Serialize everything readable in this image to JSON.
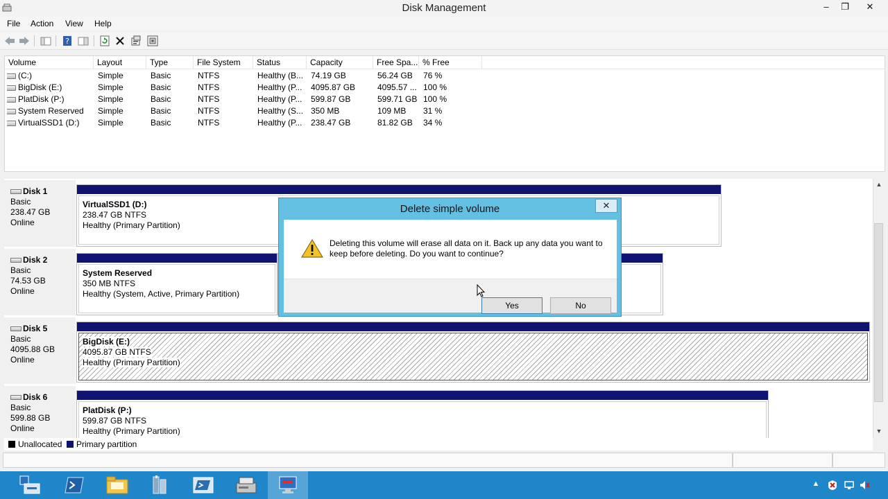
{
  "window": {
    "title": "Disk Management",
    "minimize": "‒",
    "maximize": "❐",
    "close": "✕"
  },
  "menu": [
    "File",
    "Action",
    "View",
    "Help"
  ],
  "volume_list": {
    "headers": [
      "Volume",
      "Layout",
      "Type",
      "File System",
      "Status",
      "Capacity",
      "Free Spa...",
      "% Free"
    ],
    "rows": [
      [
        "(C:)",
        "Simple",
        "Basic",
        "NTFS",
        "Healthy (B...",
        "74.19 GB",
        "56.24 GB",
        "76 %"
      ],
      [
        "BigDisk (E:)",
        "Simple",
        "Basic",
        "NTFS",
        "Healthy (P...",
        "4095.87 GB",
        "4095.57 ...",
        "100 %"
      ],
      [
        "PlatDisk (P:)",
        "Simple",
        "Basic",
        "NTFS",
        "Healthy (P...",
        "599.87 GB",
        "599.71 GB",
        "100 %"
      ],
      [
        "System Reserved",
        "Simple",
        "Basic",
        "NTFS",
        "Healthy (S...",
        "350 MB",
        "109 MB",
        "31 %"
      ],
      [
        "VirtualSSD1 (D:)",
        "Simple",
        "Basic",
        "NTFS",
        "Healthy (P...",
        "238.47 GB",
        "81.82 GB",
        "34 %"
      ]
    ]
  },
  "disks": [
    {
      "name": "Disk 1",
      "type": "Basic",
      "size": "238.47 GB",
      "state": "Online",
      "partition": {
        "name": "VirtualSSD1  (D:)",
        "fs": "238.47 GB NTFS",
        "status": "Healthy (Primary Partition)"
      }
    },
    {
      "name": "Disk 2",
      "type": "Basic",
      "size": "74.53 GB",
      "state": "Online",
      "partition": {
        "name": "System Reserved",
        "fs": "350 MB NTFS",
        "status": "Healthy (System, Active, Primary Partition)"
      }
    },
    {
      "name": "Disk 5",
      "type": "Basic",
      "size": "4095.88 GB",
      "state": "Online",
      "partition": {
        "name": "BigDisk  (E:)",
        "fs": "4095.87 GB NTFS",
        "status": "Healthy (Primary Partition)"
      }
    },
    {
      "name": "Disk 6",
      "type": "Basic",
      "size": "599.88 GB",
      "state": "Online",
      "partition": {
        "name": "PlatDisk  (P:)",
        "fs": "599.87 GB NTFS",
        "status": "Healthy (Primary Partition)"
      }
    }
  ],
  "legend": {
    "unallocated": "Unallocated",
    "primary": "Primary partition",
    "unallocated_color": "#000000",
    "primary_color": "#101470"
  },
  "dialog": {
    "title": "Delete simple volume",
    "message": "Deleting this volume will erase all data on it. Back up any data you want to keep before deleting. Do you want to continue?",
    "yes": "Yes",
    "no": "No",
    "close": "✕",
    "icon": "warning-icon"
  },
  "colors": {
    "partition_bar": "#101470",
    "dialog_frame": "#64c0e3",
    "taskbar": "#1f86c9"
  }
}
